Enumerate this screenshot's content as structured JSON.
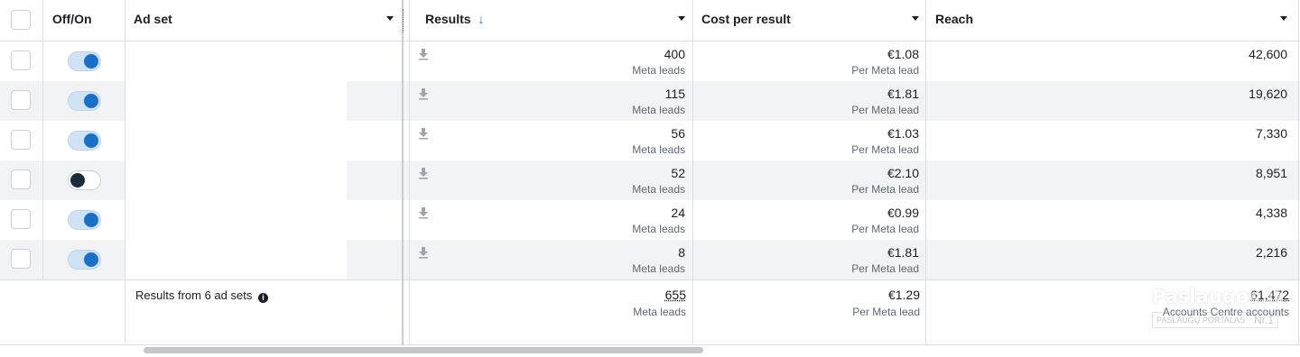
{
  "header": {
    "off_on": "Off/On",
    "ad_set": "Ad set",
    "results": "Results",
    "sort_icon": "arrow-down",
    "cost_per_result": "Cost per result",
    "reach": "Reach"
  },
  "rows": [
    {
      "toggle": "on",
      "results": "400",
      "results_unit": "Meta leads",
      "cost": "€1.08",
      "cost_unit": "Per Meta lead",
      "reach": "42,600"
    },
    {
      "toggle": "on",
      "results": "115",
      "results_unit": "Meta leads",
      "cost": "€1.81",
      "cost_unit": "Per Meta lead",
      "reach": "19,620"
    },
    {
      "toggle": "on",
      "results": "56",
      "results_unit": "Meta leads",
      "cost": "€1.03",
      "cost_unit": "Per Meta lead",
      "reach": "7,330"
    },
    {
      "toggle": "off",
      "results": "52",
      "results_unit": "Meta leads",
      "cost": "€2.10",
      "cost_unit": "Per Meta lead",
      "reach": "8,951"
    },
    {
      "toggle": "on",
      "results": "24",
      "results_unit": "Meta leads",
      "cost": "€0.99",
      "cost_unit": "Per Meta lead",
      "reach": "4,338"
    },
    {
      "toggle": "on",
      "results": "8",
      "results_unit": "Meta leads",
      "cost": "€1.81",
      "cost_unit": "Per Meta lead",
      "reach": "2,216"
    }
  ],
  "summary": {
    "label": "Results from 6 ad sets",
    "results": "655",
    "results_unit": "Meta leads",
    "cost": "€1.29",
    "cost_unit": "Per Meta lead",
    "reach": "61,472",
    "reach_unit": "Accounts Centre accounts"
  },
  "watermark": {
    "line1": "Paslaugos.lt",
    "line2": "PASLAUGŲ PORTALAS",
    "line3": "Nr.1"
  },
  "colors": {
    "toggle_on": "#1a6fc7",
    "toggle_off": "#1c2b3a",
    "row_alt": "#f2f3f5",
    "border": "#dddfe2"
  }
}
